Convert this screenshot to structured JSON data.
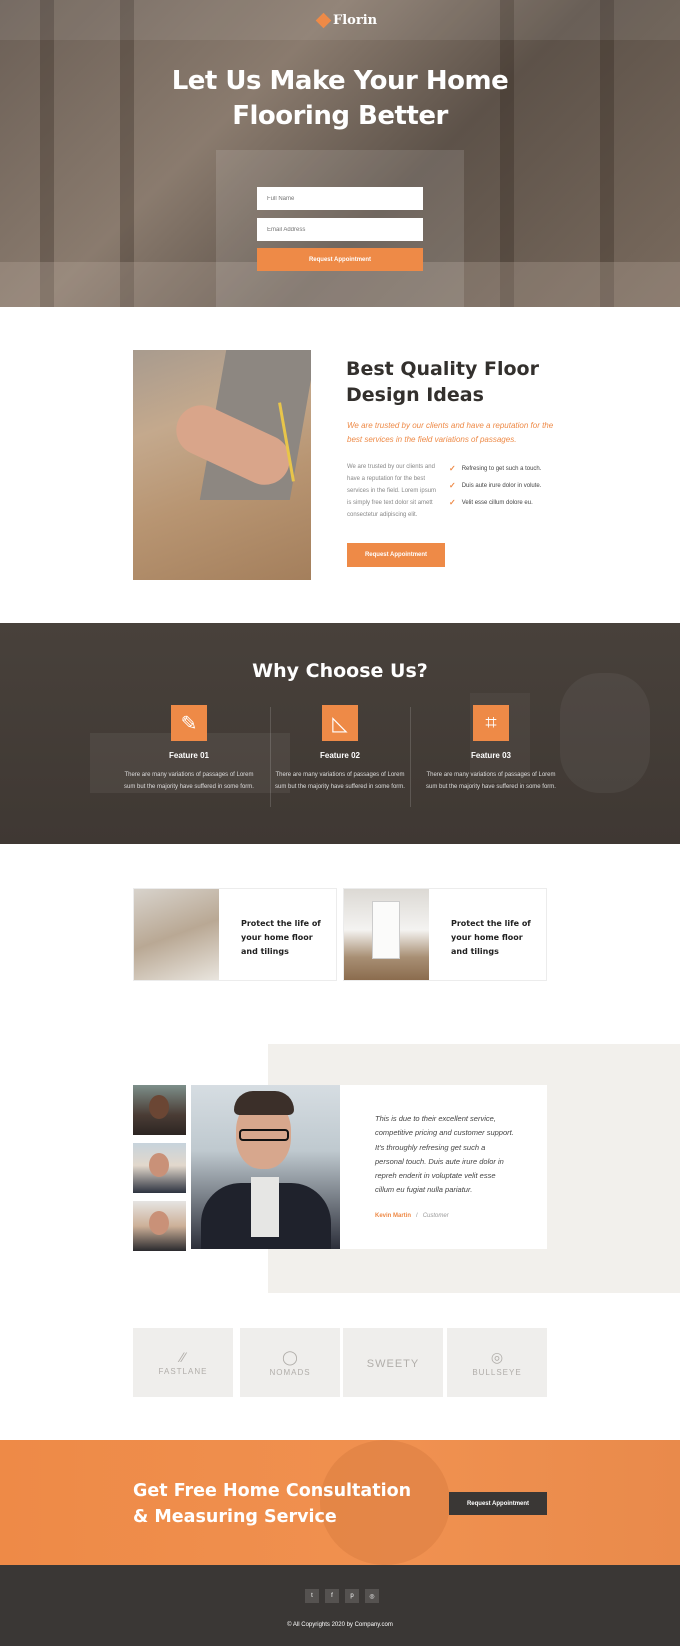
{
  "brand": {
    "name": "Florin",
    "accent": "#ee8a47",
    "dark": "#3a3735"
  },
  "hero": {
    "title_line1": "Let Us Make Your Home",
    "title_line2": "Flooring Better",
    "name_placeholder": "Full Name",
    "email_placeholder": "Email Address",
    "button": "Request Appointment"
  },
  "about": {
    "title_line1": "Best Quality Floor",
    "title_line2": "Design Ideas",
    "lead": "We are trusted by our clients and have a reputation for the best services in the field variations of passages.",
    "body": "We are trusted by our clients and have a reputation for the best services in the field. Lorem ipsum is simply free text dolor sit amett consectetur adipiscing elit.",
    "checks": [
      "Refresing to get such a touch.",
      "Duis aute irure dolor in volute.",
      "Velit esse cillum dolore eu."
    ],
    "button": "Request Appointment"
  },
  "why": {
    "title": "Why Choose Us?",
    "features": [
      {
        "icon": "pencil-ruler-icon",
        "title": "Feature 01",
        "text": "There are many variations of passages of Lorem sum but the majority have suffered in some form."
      },
      {
        "icon": "set-square-icon",
        "title": "Feature 02",
        "text": "There are many variations of passages of Lorem sum but the majority have suffered in some form."
      },
      {
        "icon": "crop-icon",
        "title": "Feature 03",
        "text": "There are many variations of passages of Lorem sum but the majority have suffered in some form."
      }
    ]
  },
  "cards": [
    {
      "title": "Protect the life of your home floor and tilings"
    },
    {
      "title": "Protect the life of your home floor and tilings"
    }
  ],
  "testimonial": {
    "quote": "This is due to their excellent service, competitive pricing and customer support. It's throughly refresing get such a personal touch. Duis aute irure dolor in repreh enderit in voluptate velit esse cillum eu fugiat nulla pariatur.",
    "name": "Kevin Martin",
    "separator": "/",
    "role": "Customer"
  },
  "clients": [
    {
      "name": "FASTLANE",
      "icon": "slashes-icon"
    },
    {
      "name": "NOMADS",
      "icon": "circle-nc-icon"
    },
    {
      "name": "SWEETY",
      "icon": ""
    },
    {
      "name": "BULLSEYE",
      "icon": "target-icon"
    }
  ],
  "cta": {
    "title_line1": "Get Free Home Consultation",
    "title_line2": "& Measuring Service",
    "button": "Request Appointment"
  },
  "footer": {
    "social": [
      {
        "icon": "twitter-icon",
        "glyph": "t"
      },
      {
        "icon": "facebook-icon",
        "glyph": "f"
      },
      {
        "icon": "pinterest-icon",
        "glyph": "p"
      },
      {
        "icon": "instagram-icon",
        "glyph": "◎"
      }
    ],
    "copyright": "© All Copyrights 2020 by Company.com"
  }
}
